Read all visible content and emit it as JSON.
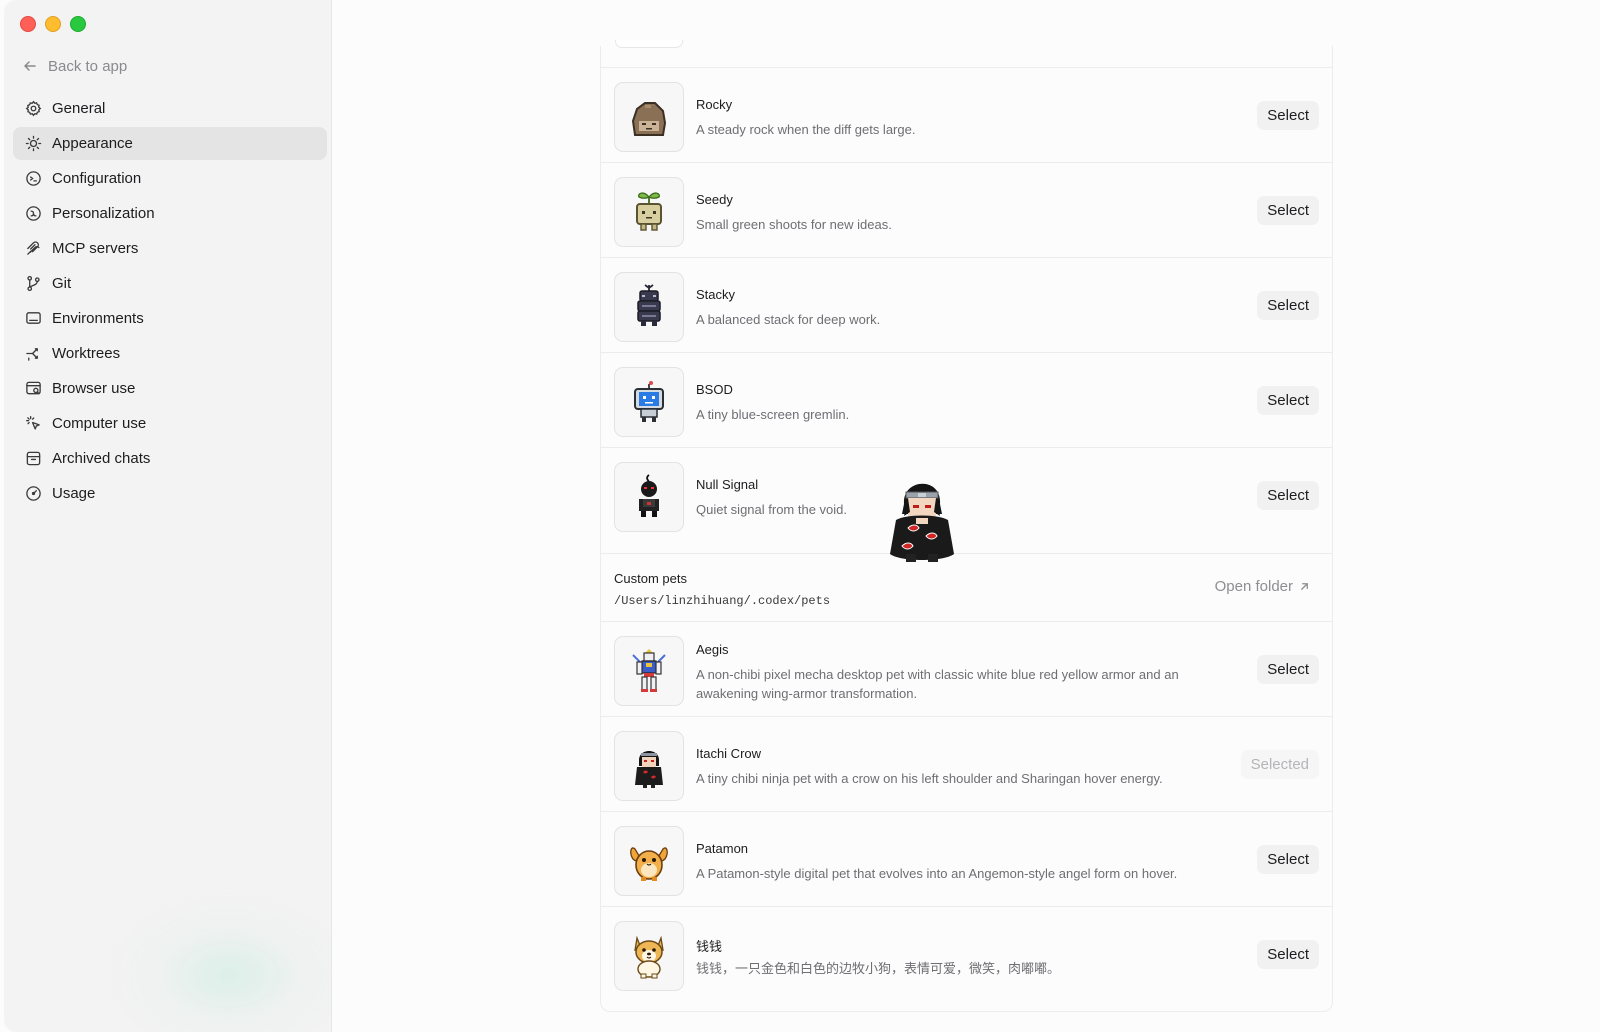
{
  "sidebar": {
    "back_label": "Back to app",
    "items": [
      {
        "label": "General",
        "icon": "gear-icon",
        "active": false
      },
      {
        "label": "Appearance",
        "icon": "sun-icon",
        "active": true
      },
      {
        "label": "Configuration",
        "icon": "config-icon",
        "active": false
      },
      {
        "label": "Personalization",
        "icon": "personalization-icon",
        "active": false
      },
      {
        "label": "MCP servers",
        "icon": "mcp-icon",
        "active": false
      },
      {
        "label": "Git",
        "icon": "git-branch-icon",
        "active": false
      },
      {
        "label": "Environments",
        "icon": "monitor-icon",
        "active": false
      },
      {
        "label": "Worktrees",
        "icon": "worktree-icon",
        "active": false
      },
      {
        "label": "Browser use",
        "icon": "browser-icon",
        "active": false
      },
      {
        "label": "Computer use",
        "icon": "cursor-click-icon",
        "active": false
      },
      {
        "label": "Archived chats",
        "icon": "archive-icon",
        "active": false
      },
      {
        "label": "Usage",
        "icon": "gauge-icon",
        "active": false
      }
    ]
  },
  "pets": [
    {
      "name": "Rocky",
      "description": "A steady rock when the diff gets large.",
      "button": "Select",
      "icon": "rock-pet-icon"
    },
    {
      "name": "Seedy",
      "description": "Small green shoots for new ideas.",
      "button": "Select",
      "icon": "sprout-pet-icon"
    },
    {
      "name": "Stacky",
      "description": "A balanced stack for deep work.",
      "button": "Select",
      "icon": "stack-pet-icon"
    },
    {
      "name": "BSOD",
      "description": "A tiny blue-screen gremlin.",
      "button": "Select",
      "icon": "monitor-pet-icon"
    },
    {
      "name": "Null Signal",
      "description": "Quiet signal from the void.",
      "button": "Select",
      "icon": "shadow-pet-icon"
    }
  ],
  "custom": {
    "title": "Custom pets",
    "path": "/Users/linzhihuang/.codex/pets",
    "open_label": "Open folder"
  },
  "custom_pets": [
    {
      "name": "Aegis",
      "description": "A non-chibi pixel mecha desktop pet with classic white blue red yellow armor and an awakening wing-armor transformation.",
      "button": "Select",
      "icon": "mecha-pet-icon"
    },
    {
      "name": "Itachi Crow",
      "description": "A tiny chibi ninja pet with a crow on his left shoulder and Sharingan hover energy.",
      "button": "Selected",
      "icon": "ninja-pet-icon"
    },
    {
      "name": "Patamon",
      "description": "A Patamon-style digital pet that evolves into an Angemon-style angel form on hover.",
      "button": "Select",
      "icon": "winged-pet-icon"
    },
    {
      "name": "钱钱",
      "description": "钱钱，一只金色和白色的边牧小狗，表情可爱，微笑，肉嘟嘟。",
      "button": "Select",
      "icon": "dog-pet-icon"
    }
  ],
  "colors": {
    "accent": "#1d1d1f",
    "muted": "#6e6e73",
    "sidebar_bg": "#f3f3f3",
    "active_bg": "#e4e4e4"
  }
}
